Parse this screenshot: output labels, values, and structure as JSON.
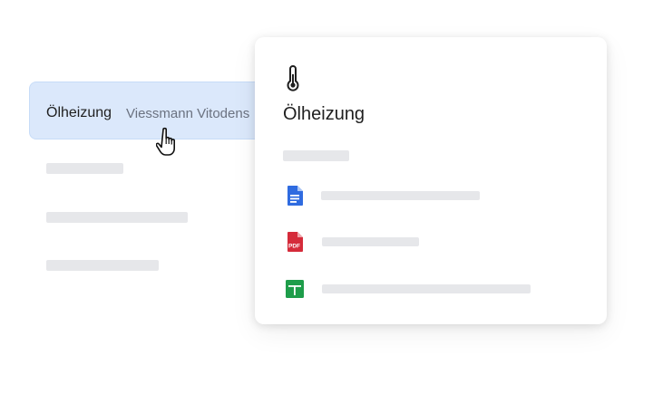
{
  "list": {
    "selected_item": {
      "title": "Ölheizung",
      "subtitle": "Viessmann Vitodens"
    }
  },
  "card": {
    "icon": "thermometer-icon",
    "title": "Ölheizung",
    "files": [
      {
        "type": "google-docs-icon",
        "color": "#2f6be0"
      },
      {
        "type": "pdf-icon",
        "label": "PDF",
        "color": "#d52b3a"
      },
      {
        "type": "google-sheets-icon",
        "color": "#1e9d4a"
      }
    ]
  }
}
